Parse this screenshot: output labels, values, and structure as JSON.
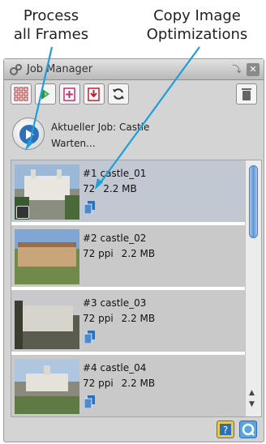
{
  "annotations": {
    "left": [
      "Process",
      "all Frames"
    ],
    "right": [
      "Copy Image",
      "Optimizations"
    ]
  },
  "window": {
    "title": "Job Manager",
    "collapse_icon": "collapse-icon",
    "close_icon": "close-icon"
  },
  "toolbar": {
    "buttons": [
      {
        "name": "grid-layout-button",
        "icon": "grid-icon"
      },
      {
        "name": "merge-button",
        "icon": "green-arrows-icon"
      },
      {
        "name": "add-image-button",
        "icon": "add-frame-icon"
      },
      {
        "name": "import-button",
        "icon": "import-arrow-icon"
      },
      {
        "name": "refresh-button",
        "icon": "refresh-icon"
      },
      {
        "name": "delete-button",
        "icon": "trash-icon"
      }
    ]
  },
  "job": {
    "current": "Aktueller Job: Castle",
    "status": "Warten..."
  },
  "items": [
    {
      "name": "#1 castle_01",
      "ppi": "72",
      "size": "2.2 MB",
      "selected": true
    },
    {
      "name": "#2 castle_02",
      "ppi": "72 ppi",
      "size": "2.2 MB",
      "selected": false
    },
    {
      "name": "#3 castle_03",
      "ppi": "72 ppi",
      "size": "2.2 MB",
      "selected": false
    },
    {
      "name": "#4 castle_04",
      "ppi": "72 ppi",
      "size": "2.2 MB",
      "selected": false
    }
  ],
  "colors": {
    "accent": "#2f6fb8",
    "arrow": "#1e9fdc",
    "selection": "#c2c8d2"
  },
  "footer": {
    "help_icon": "help-icon",
    "app_icon": "app-logo-icon"
  }
}
